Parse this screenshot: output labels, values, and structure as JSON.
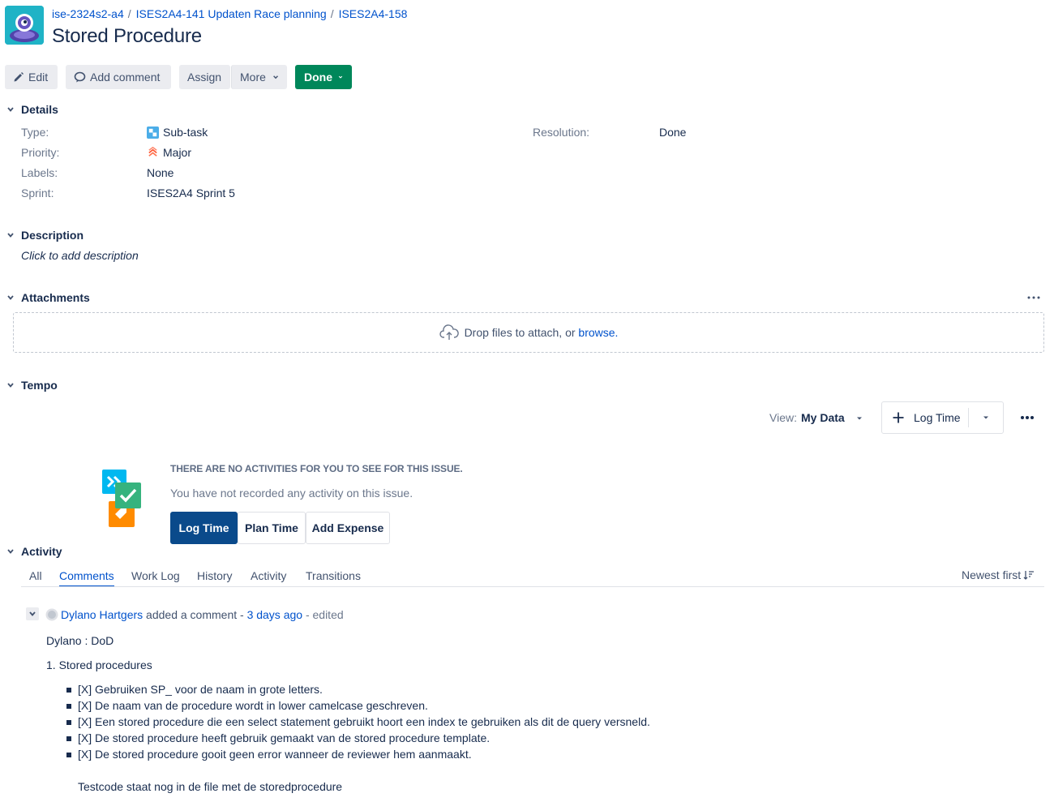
{
  "breadcrumbs": [
    "ise-2324s2-a4",
    "ISES2A4-141 Updaten Race planning",
    "ISES2A4-158"
  ],
  "breadcrumb_separator": "/",
  "title": "Stored Procedure",
  "toolbar": {
    "edit": "Edit",
    "add_comment": "Add comment",
    "assign": "Assign",
    "more": "More",
    "done": "Done"
  },
  "details": {
    "heading": "Details",
    "type_label": "Type:",
    "type_value": "Sub-task",
    "priority_label": "Priority:",
    "priority_value": "Major",
    "labels_label": "Labels:",
    "labels_value": "None",
    "sprint_label": "Sprint:",
    "sprint_value": "ISES2A4 Sprint 5",
    "resolution_label": "Resolution:",
    "resolution_value": "Done"
  },
  "description": {
    "heading": "Description",
    "placeholder": "Click to add description"
  },
  "attachments": {
    "heading": "Attachments",
    "drop_text": "Drop files to attach, or ",
    "browse": "browse."
  },
  "tempo": {
    "heading": "Tempo",
    "view_label": "View:",
    "view_value": "My Data",
    "log_time": "Log Time",
    "empty_title": "THERE ARE NO ACTIVITIES FOR YOU TO SEE FOR THIS ISSUE.",
    "empty_subtitle": "You have not recorded any activity on this issue.",
    "btn_log_time": "Log Time",
    "btn_plan_time": "Plan Time",
    "btn_add_expense": "Add Expense"
  },
  "activity": {
    "heading": "Activity",
    "tabs": [
      "All",
      "Comments",
      "Work Log",
      "History",
      "Activity",
      "Transitions"
    ],
    "active_tab": "Comments",
    "sort": "Newest first"
  },
  "comment": {
    "author": "Dylano Hartgers",
    "action": " added a comment - ",
    "time": "3 days ago",
    "edited": " - edited",
    "line1": "Dylano : DoD",
    "line2": "1. Stored procedures",
    "items": [
      "[X] Gebruiken SP_ voor de naam in grote letters.",
      "[X] De naam van de procedure wordt in lower camelcase geschreven.",
      "[X] Een stored procedure die een select statement gebruikt hoort een index te gebruiken als dit de query versneld.",
      "[X] De stored procedure heeft gebruik gemaakt van de stored procedure template.",
      "[X] De stored procedure gooit geen error wanneer de reviewer hem aanmaakt."
    ],
    "footer": "Testcode staat nog in de file met de storedprocedure"
  },
  "colors": {
    "link": "#0052cc",
    "done_green": "#00875a",
    "tempo_primary": "#0a4a8b",
    "major_priority": "#ff5630"
  },
  "icons": [
    "project-avatar-icon",
    "pencil-icon",
    "comment-icon",
    "chevron-down-icon",
    "subtask-icon",
    "major-priority-icon",
    "cloud-upload-icon",
    "plus-icon",
    "more-dots-icon",
    "tempo-illustration",
    "sort-icon",
    "user-avatar-icon"
  ]
}
